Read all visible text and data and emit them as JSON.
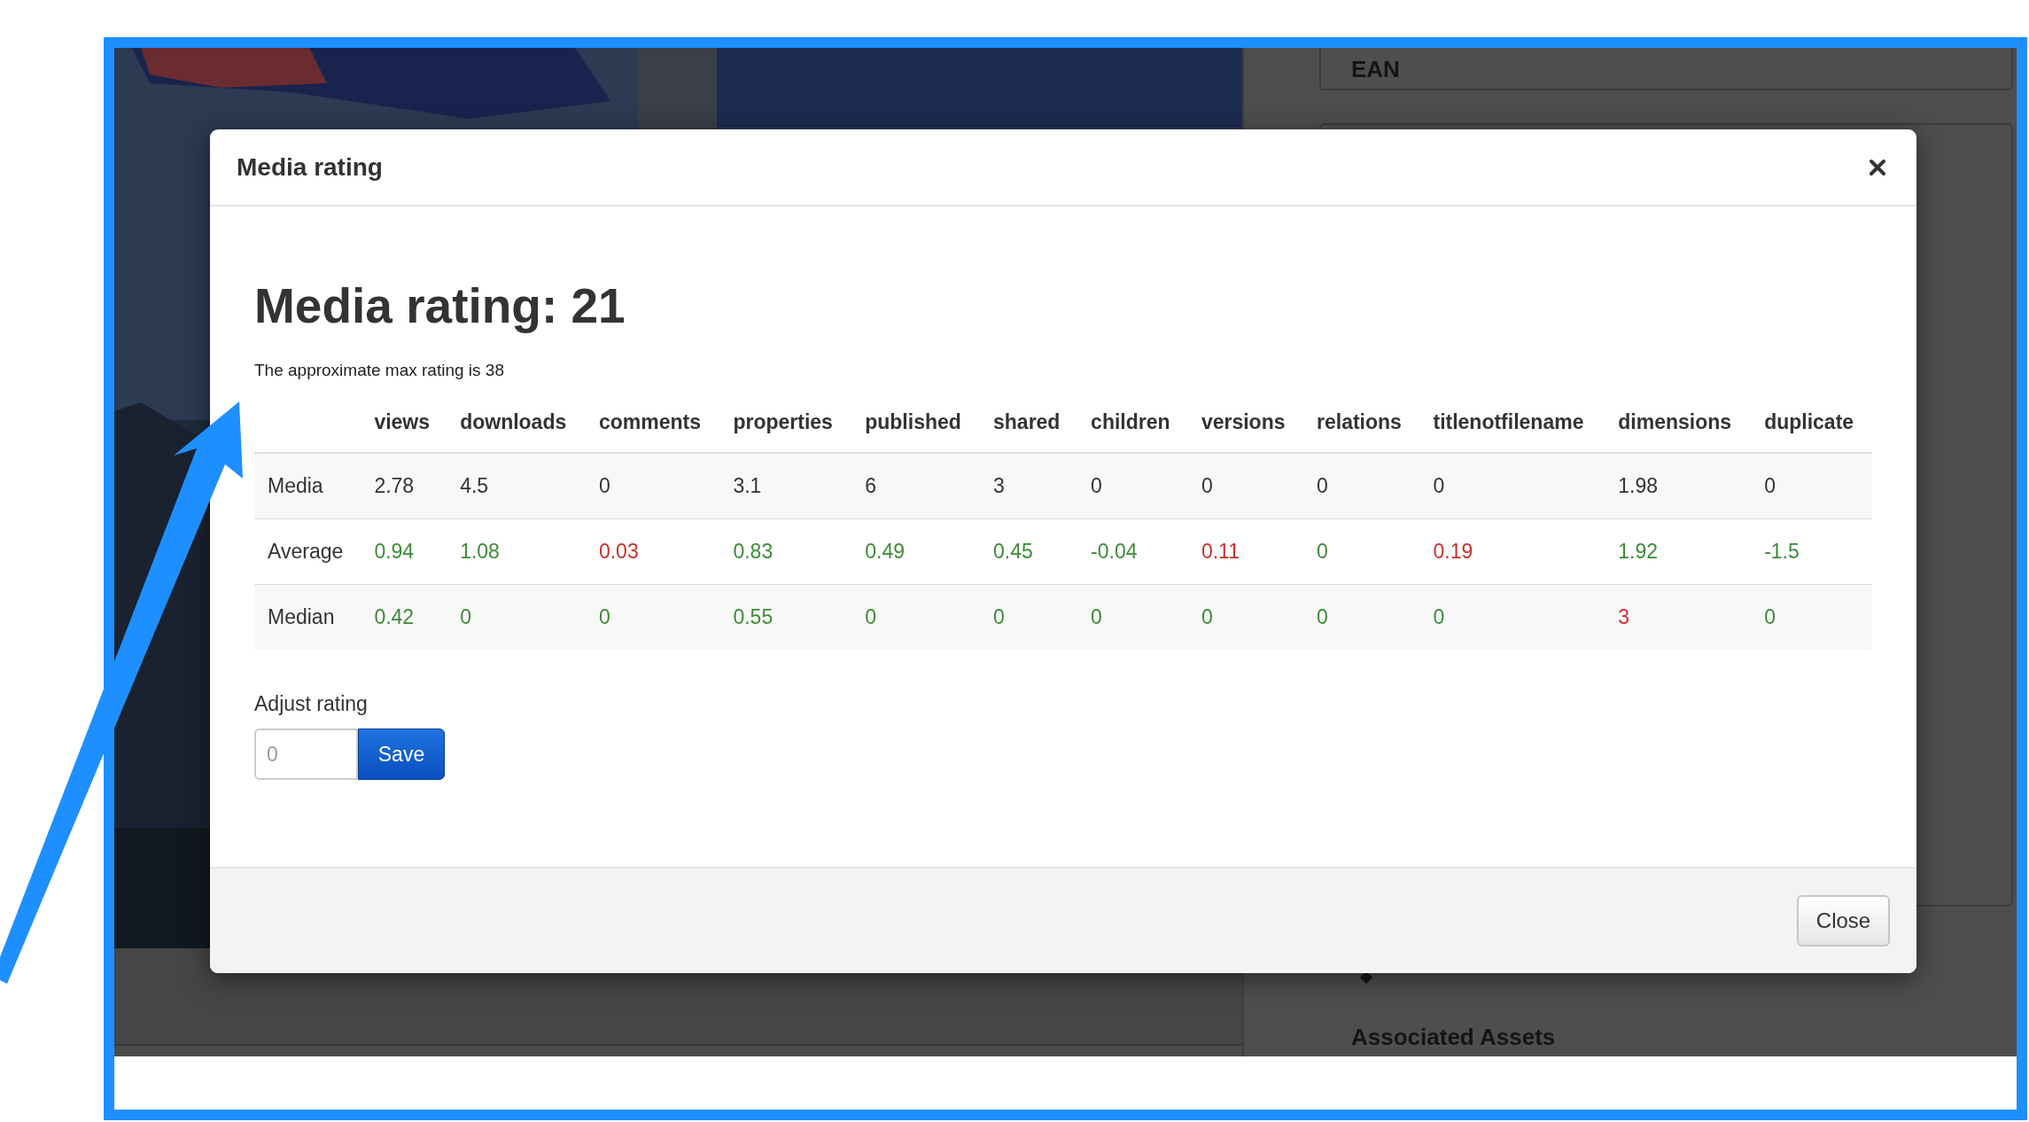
{
  "background": {
    "field_label": "EAN",
    "section_title": "Associated Assets"
  },
  "modal": {
    "title": "Media rating",
    "heading": "Media rating: 21",
    "note": "The approximate max rating is 38",
    "table": {
      "columns": [
        "views",
        "downloads",
        "comments",
        "properties",
        "published",
        "shared",
        "children",
        "versions",
        "relations",
        "titlenotfilename",
        "dimensions",
        "duplicate"
      ],
      "rows": [
        {
          "label": "Media",
          "cells": [
            {
              "value": "2.78",
              "color": "#333333"
            },
            {
              "value": "4.5",
              "color": "#333333"
            },
            {
              "value": "0",
              "color": "#333333"
            },
            {
              "value": "3.1",
              "color": "#333333"
            },
            {
              "value": "6",
              "color": "#333333"
            },
            {
              "value": "3",
              "color": "#333333"
            },
            {
              "value": "0",
              "color": "#333333"
            },
            {
              "value": "0",
              "color": "#333333"
            },
            {
              "value": "0",
              "color": "#333333"
            },
            {
              "value": "0",
              "color": "#333333"
            },
            {
              "value": "1.98",
              "color": "#333333"
            },
            {
              "value": "0",
              "color": "#333333"
            }
          ]
        },
        {
          "label": "Average",
          "cells": [
            {
              "value": "0.94",
              "color": "#3d8b37"
            },
            {
              "value": "1.08",
              "color": "#3d8b37"
            },
            {
              "value": "0.03",
              "color": "#c9302c"
            },
            {
              "value": "0.83",
              "color": "#3d8b37"
            },
            {
              "value": "0.49",
              "color": "#3d8b37"
            },
            {
              "value": "0.45",
              "color": "#3d8b37"
            },
            {
              "value": "-0.04",
              "color": "#3d8b37"
            },
            {
              "value": "0.11",
              "color": "#c9302c"
            },
            {
              "value": "0",
              "color": "#3d8b37"
            },
            {
              "value": "0.19",
              "color": "#c9302c"
            },
            {
              "value": "1.92",
              "color": "#3d8b37"
            },
            {
              "value": "-1.5",
              "color": "#3d8b37"
            }
          ]
        },
        {
          "label": "Median",
          "cells": [
            {
              "value": "0.42",
              "color": "#3d8b37"
            },
            {
              "value": "0",
              "color": "#3d8b37"
            },
            {
              "value": "0",
              "color": "#3d8b37"
            },
            {
              "value": "0.55",
              "color": "#3d8b37"
            },
            {
              "value": "0",
              "color": "#3d8b37"
            },
            {
              "value": "0",
              "color": "#3d8b37"
            },
            {
              "value": "0",
              "color": "#3d8b37"
            },
            {
              "value": "0",
              "color": "#3d8b37"
            },
            {
              "value": "0",
              "color": "#3d8b37"
            },
            {
              "value": "0",
              "color": "#3d8b37"
            },
            {
              "value": "3",
              "color": "#c9302c"
            },
            {
              "value": "0",
              "color": "#3d8b37"
            }
          ]
        }
      ]
    },
    "adjust": {
      "label": "Adjust rating",
      "placeholder": "0",
      "button": "Save"
    },
    "footer_button": "Close"
  }
}
